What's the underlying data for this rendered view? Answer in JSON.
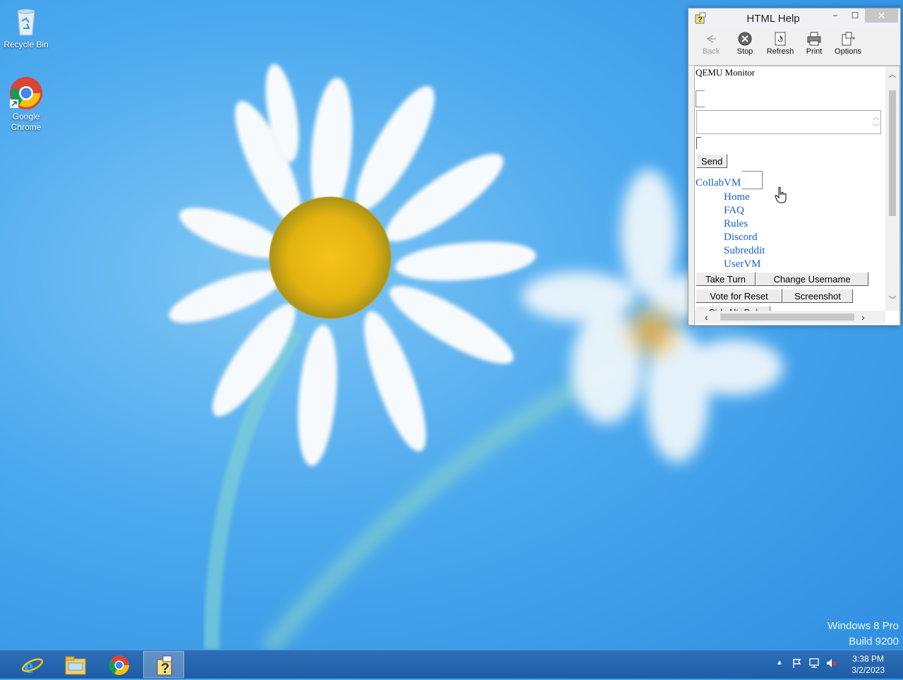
{
  "desktop": {
    "icons": [
      {
        "label": "Recycle Bin",
        "icon": "recycle-bin-icon"
      },
      {
        "label": "Google Chrome",
        "icon": "chrome-icon"
      }
    ],
    "watermark": {
      "line1": "Windows 8 Pro",
      "line2": "Build 9200"
    }
  },
  "window": {
    "title": "HTML Help",
    "controls": {
      "minimize": "−",
      "maximize": "☐",
      "close": "✕"
    },
    "toolbar": [
      {
        "label": "Back",
        "icon": "back-arrow-icon",
        "enabled": false
      },
      {
        "label": "Stop",
        "icon": "stop-icon",
        "enabled": true
      },
      {
        "label": "Refresh",
        "icon": "refresh-icon",
        "enabled": true
      },
      {
        "label": "Print",
        "icon": "print-icon",
        "enabled": true
      },
      {
        "label": "Options",
        "icon": "options-icon",
        "enabled": true
      }
    ],
    "content": {
      "page_title": "QEMU Monitor",
      "send_label": "Send",
      "collab_label": "CollabVM",
      "nav_links": [
        "Home",
        "FAQ",
        "Rules",
        "Discord",
        "Subreddit",
        "UserVM"
      ],
      "buttons": {
        "take_turn": "Take Turn",
        "change_username": "Change Username",
        "vote_reset": "Vote for Reset",
        "screenshot": "Screenshot",
        "ctrl_alt_del": "Ctrl+Alt+Del"
      }
    }
  },
  "taskbar": {
    "apps": [
      {
        "name": "Internet Explorer",
        "icon": "internet-explorer-icon"
      },
      {
        "name": "File Explorer",
        "icon": "file-explorer-icon"
      },
      {
        "name": "Google Chrome",
        "icon": "chrome-icon"
      },
      {
        "name": "HTML Help",
        "icon": "html-help-icon",
        "active": true
      }
    ],
    "clock": {
      "time": "3:38 PM",
      "date": "3/2/2023"
    }
  },
  "colors": {
    "accent": "#1e5da6",
    "link": "#1a5fc8",
    "wallpaper": "#4aa8ee"
  }
}
